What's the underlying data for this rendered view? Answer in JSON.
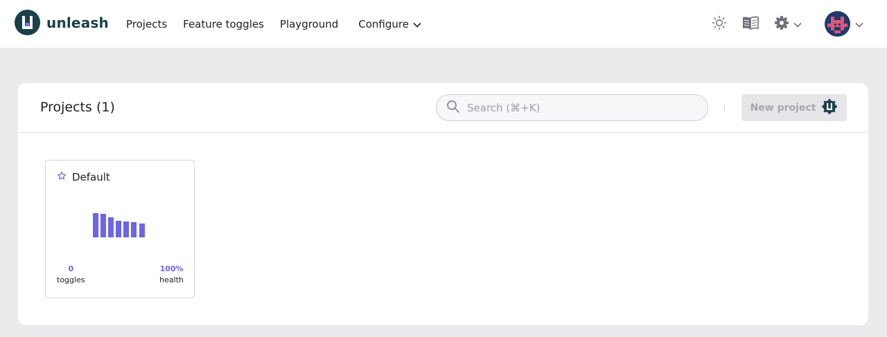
{
  "brand": {
    "name": "unleash"
  },
  "nav": {
    "items": [
      {
        "label": "Projects"
      },
      {
        "label": "Feature toggles"
      },
      {
        "label": "Playground"
      },
      {
        "label": "Configure"
      }
    ]
  },
  "page": {
    "title": "Projects (1)",
    "search_placeholder": "Search (⌘+K)",
    "new_project_label": "New project"
  },
  "projects": [
    {
      "name": "Default",
      "toggles": "0",
      "toggles_label": "toggles",
      "health": "100%",
      "health_label": "health"
    }
  ],
  "colors": {
    "brand": "#1a4049",
    "accent": "#6c65e5"
  },
  "icons": {
    "theme": "sun-icon",
    "docs": "book-icon",
    "settings": "gear-icon",
    "search": "search-icon",
    "favorite": "star-icon"
  }
}
